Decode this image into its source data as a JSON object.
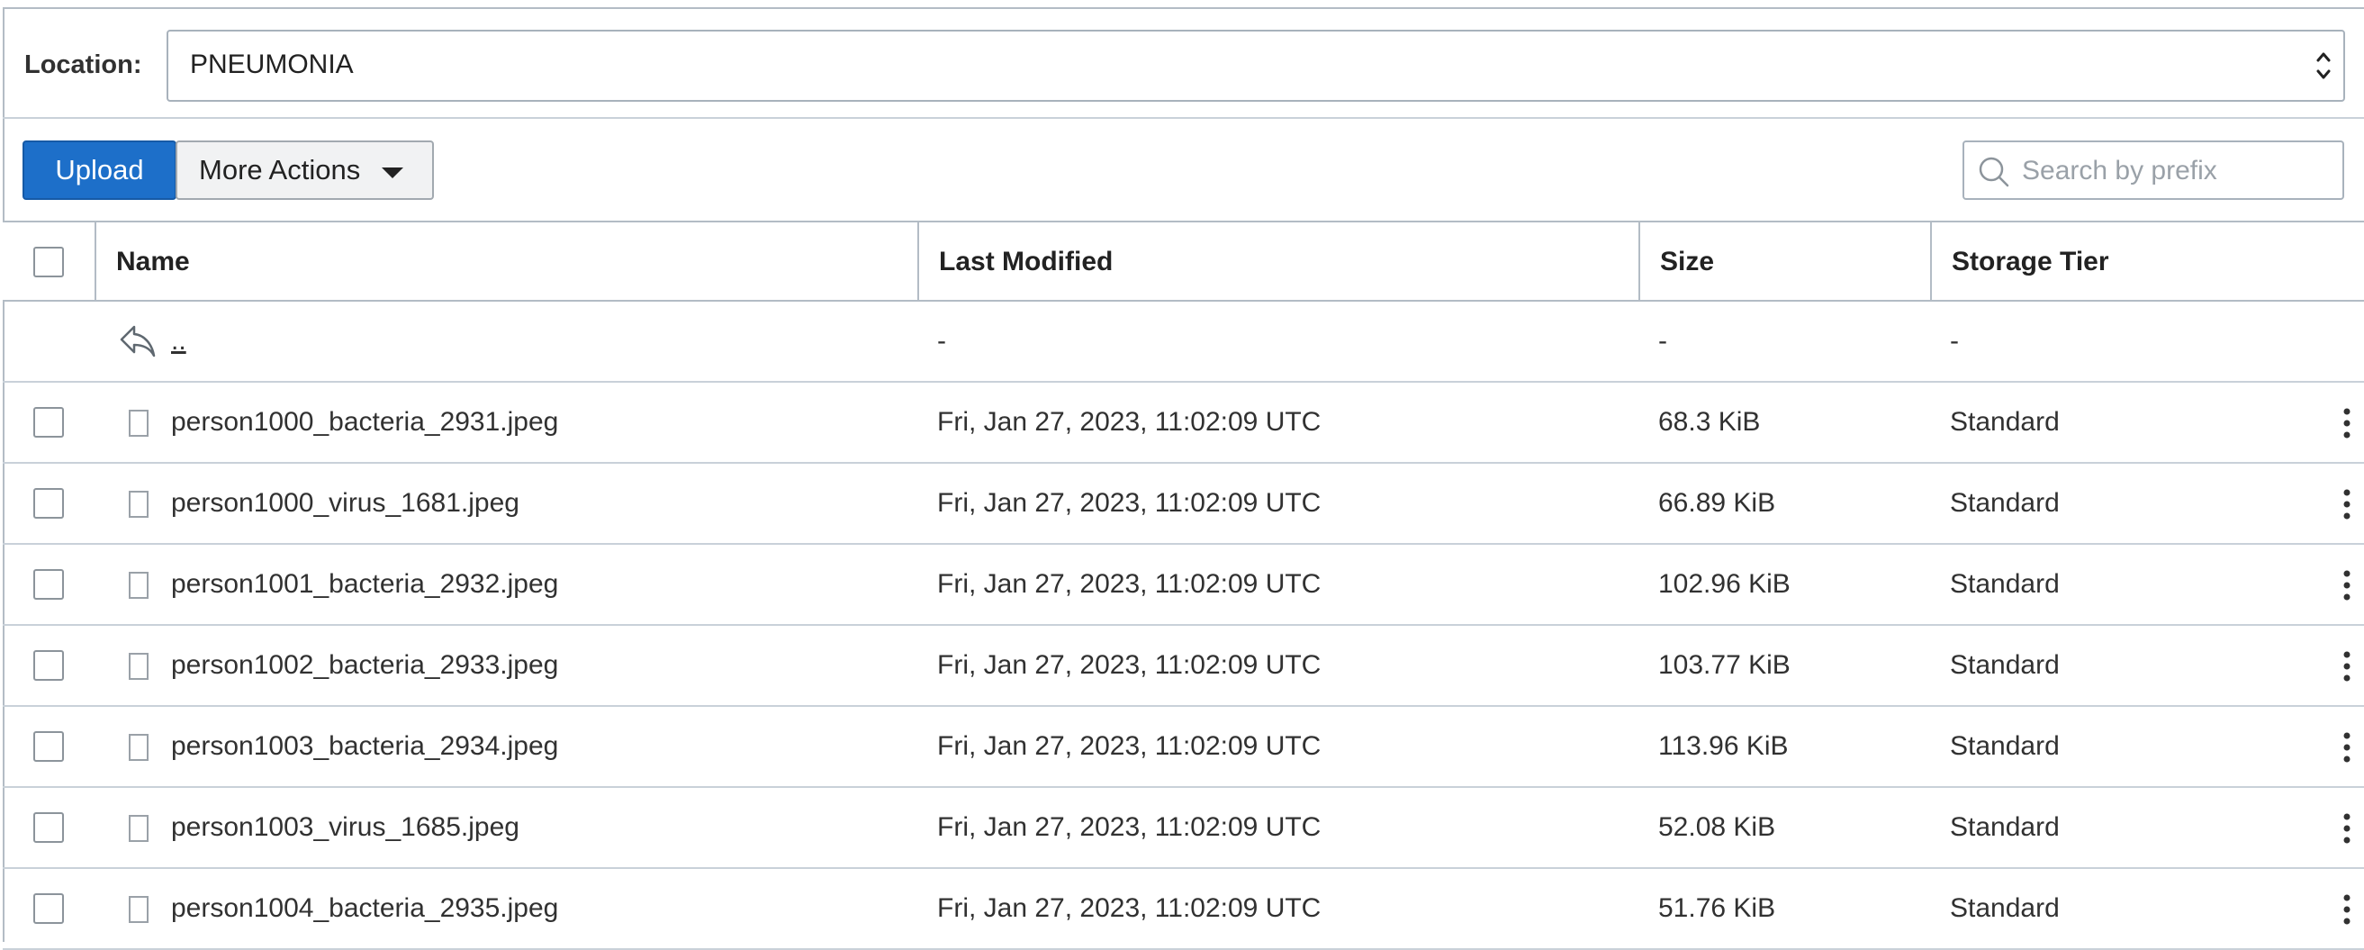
{
  "location": {
    "label": "Location:",
    "value": "PNEUMONIA"
  },
  "toolbar": {
    "upload_label": "Upload",
    "more_actions_label": "More Actions",
    "search_placeholder": "Search by prefix",
    "search_value": ""
  },
  "table": {
    "columns": [
      "Name",
      "Last Modified",
      "Size",
      "Storage Tier"
    ],
    "parent_row": {
      "name": "..",
      "last_modified": "-",
      "size": "-",
      "storage_tier": "-"
    },
    "rows": [
      {
        "name": "person1000_bacteria_2931.jpeg",
        "last_modified": "Fri, Jan 27, 2023, 11:02:09 UTC",
        "size": "68.3 KiB",
        "storage_tier": "Standard"
      },
      {
        "name": "person1000_virus_1681.jpeg",
        "last_modified": "Fri, Jan 27, 2023, 11:02:09 UTC",
        "size": "66.89 KiB",
        "storage_tier": "Standard"
      },
      {
        "name": "person1001_bacteria_2932.jpeg",
        "last_modified": "Fri, Jan 27, 2023, 11:02:09 UTC",
        "size": "102.96 KiB",
        "storage_tier": "Standard"
      },
      {
        "name": "person1002_bacteria_2933.jpeg",
        "last_modified": "Fri, Jan 27, 2023, 11:02:09 UTC",
        "size": "103.77 KiB",
        "storage_tier": "Standard"
      },
      {
        "name": "person1003_bacteria_2934.jpeg",
        "last_modified": "Fri, Jan 27, 2023, 11:02:09 UTC",
        "size": "113.96 KiB",
        "storage_tier": "Standard"
      },
      {
        "name": "person1003_virus_1685.jpeg",
        "last_modified": "Fri, Jan 27, 2023, 11:02:09 UTC",
        "size": "52.08 KiB",
        "storage_tier": "Standard"
      },
      {
        "name": "person1004_bacteria_2935.jpeg",
        "last_modified": "Fri, Jan 27, 2023, 11:02:09 UTC",
        "size": "51.76 KiB",
        "storage_tier": "Standard"
      }
    ]
  },
  "colors": {
    "primary_button": "#1d6fc9",
    "border": "#b3bcc5",
    "text": "#313131"
  },
  "icons": {
    "select_arrows": "chevron-up-down-icon",
    "more_actions_caret": "caret-down-icon",
    "search": "search-icon",
    "parent_folder": "reply-arrow-icon",
    "file": "file-icon",
    "row_actions": "kebab-menu-icon"
  }
}
